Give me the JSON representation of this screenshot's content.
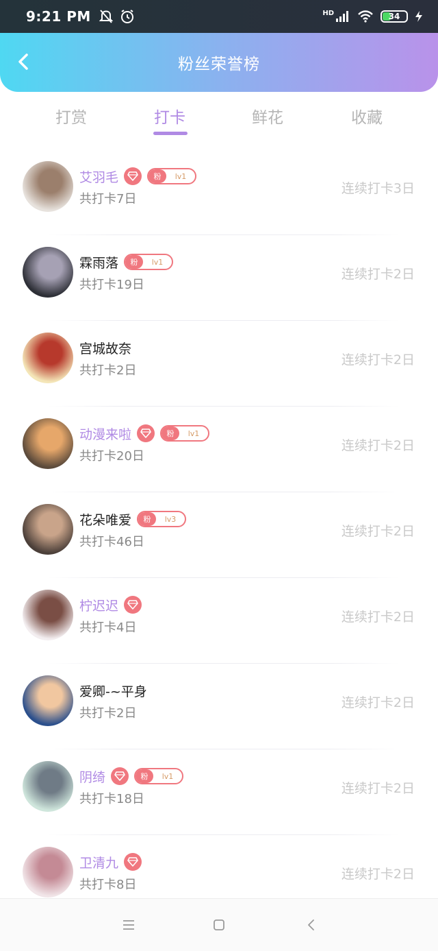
{
  "status_bar": {
    "time": "9:21 PM",
    "network": "HD",
    "battery": "34",
    "icons": [
      "mute-bell-icon",
      "alarm-icon",
      "signal-icon",
      "wifi-icon",
      "battery-icon",
      "charging-icon"
    ]
  },
  "header": {
    "title": "粉丝荣誉榜",
    "back_icon": "chevron-left-icon"
  },
  "tabs": [
    {
      "label": "打赏",
      "active": false
    },
    {
      "label": "打卡",
      "active": true
    },
    {
      "label": "鲜花",
      "active": false
    },
    {
      "label": "收藏",
      "active": false
    }
  ],
  "badges": {
    "fan_label": "粉"
  },
  "list": [
    {
      "name": "艾羽毛",
      "vip": true,
      "diamond": true,
      "fan_level": "lv1",
      "total": "共打卡7日",
      "streak": "连续打卡3日",
      "avatar_colors": [
        "#e7e2dd",
        "#9b7f6c"
      ]
    },
    {
      "name": "霖雨落",
      "vip": false,
      "diamond": false,
      "fan_level": "lv1",
      "total": "共打卡19日",
      "streak": "连续打卡2日",
      "avatar_colors": [
        "#2d2f36",
        "#a6a1b4"
      ]
    },
    {
      "name": "宫城故奈",
      "vip": false,
      "diamond": false,
      "fan_level": "",
      "total": "共打卡2日",
      "streak": "连续打卡2日",
      "avatar_colors": [
        "#f4e6b8",
        "#b7392c"
      ]
    },
    {
      "name": "动漫来啦",
      "vip": true,
      "diamond": true,
      "fan_level": "lv1",
      "total": "共打卡20日",
      "streak": "连续打卡2日",
      "avatar_colors": [
        "#5b4a3b",
        "#e6a76a"
      ]
    },
    {
      "name": "花朵唯爱",
      "vip": false,
      "diamond": false,
      "fan_level": "lv3",
      "total": "共打卡46日",
      "streak": "连续打卡2日",
      "avatar_colors": [
        "#4b3f39",
        "#c9a48a"
      ]
    },
    {
      "name": "柠迟迟",
      "vip": true,
      "diamond": true,
      "fan_level": "",
      "total": "共打卡4日",
      "streak": "连续打卡2日",
      "avatar_colors": [
        "#f3eef0",
        "#7a4e45"
      ]
    },
    {
      "name": "爱卿-~平身",
      "vip": false,
      "diamond": false,
      "fan_level": "",
      "total": "共打卡2日",
      "streak": "连续打卡2日",
      "avatar_colors": [
        "#2b4f8c",
        "#f1c7a0"
      ]
    },
    {
      "name": "阴绮",
      "vip": true,
      "diamond": true,
      "fan_level": "lv1",
      "total": "共打卡18日",
      "streak": "连续打卡2日",
      "avatar_colors": [
        "#cfe6dc",
        "#6f7b86"
      ]
    },
    {
      "name": "卫清九",
      "vip": true,
      "diamond": true,
      "fan_level": "",
      "total": "共打卡8日",
      "streak": "连续打卡2日",
      "avatar_colors": [
        "#f1e5e8",
        "#c48a95"
      ]
    }
  ],
  "bottom_nav": {
    "icons": [
      "menu-icon",
      "home-square-icon",
      "back-triangle-icon"
    ]
  }
}
